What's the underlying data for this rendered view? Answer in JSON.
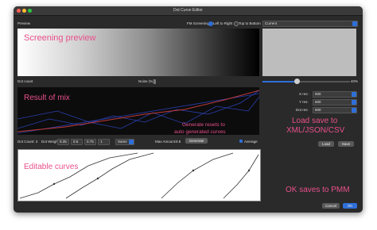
{
  "window": {
    "title": "Dot Curve Editor"
  },
  "preview": {
    "label": "Preview",
    "fm_label": "FM Screening",
    "radio_ltr": "Left to Right",
    "radio_ttb": "Top to Bottom",
    "dropdown_value": "Current",
    "annotation": "Screening preview"
  },
  "dotcount": {
    "label": "Dot count",
    "noise_label": "Noise (%)",
    "slider_value": "40%"
  },
  "mix": {
    "annotation": "Result of mix"
  },
  "res_fields": [
    {
      "label": "X res:",
      "value": "600"
    },
    {
      "label": "Y res:",
      "value": "600"
    },
    {
      "label": "Dot res:",
      "value": "600"
    }
  ],
  "controls": {
    "dot_count_label": "Dot Count: 3",
    "dot_weights_label": "Dot Weights:",
    "weights": [
      "0.35",
      "0.5",
      "0.75",
      "1"
    ],
    "mode_value": "Same",
    "max_amount_label": "Max Amount:",
    "max_amount_value": "0.6",
    "generate_label": "Generate",
    "average_label": "Average"
  },
  "annotations": {
    "generate_note_line1": "Generate resets to",
    "generate_note_line2": "auto generated curves",
    "load_save_line1": "Load save to",
    "load_save_line2": "XML/JSON/CSV",
    "editable": "Editable curves",
    "ok_saves": "OK saves to PMM"
  },
  "buttons": {
    "load": "Load",
    "save": "Save",
    "cancel": "Cancel",
    "ok": "OK"
  },
  "colors": {
    "accent": "#2e6fd8",
    "annotation": "#e8508a",
    "mix_line": "#c03a3a",
    "mix_lines_blue": "#2a3fb0"
  }
}
